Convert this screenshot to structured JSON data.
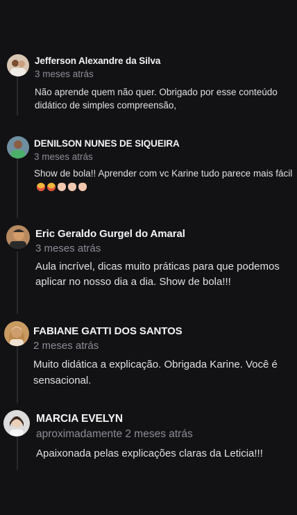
{
  "comments": [
    {
      "author": "Jefferson Alexandre da Silva",
      "time": "3 meses atrás",
      "text": "Não aprende quem não quer. Obrigado por esse conteúdo didático de simples compreensão,",
      "avatar": "avatar-photo"
    },
    {
      "author": "DENILSON NUNES DE SIQUEIRA",
      "time": "3 meses atrás",
      "text": "Show de bola!! Aprender com vc Karine tudo parece mais fácil",
      "emojis": [
        "laughing-emoji",
        "laughing-emoji",
        "clapping-hands-emoji",
        "clapping-hands-emoji",
        "clapping-hands-emoji"
      ],
      "avatar": "avatar-photo"
    },
    {
      "author": "Eric Geraldo Gurgel do Amaral",
      "time": "3 meses atrás",
      "text": "Aula incrível, dicas muito práticas para que podemos aplicar no nosso dia a dia. Show de bola!!!",
      "avatar": "avatar-photo"
    },
    {
      "author": "FABIANE GATTI DOS SANTOS",
      "time": "2 meses atrás",
      "text": "Muito didática a explicação. Obrigada Karine. Você é sensacional.",
      "avatar": "avatar-photo"
    },
    {
      "author": "MARCIA EVELYN",
      "time": "aproximadamente 2 meses atrás",
      "text": "Apaixonada pelas explicações claras da Leticia!!!",
      "avatar": "avatar-photo"
    }
  ]
}
